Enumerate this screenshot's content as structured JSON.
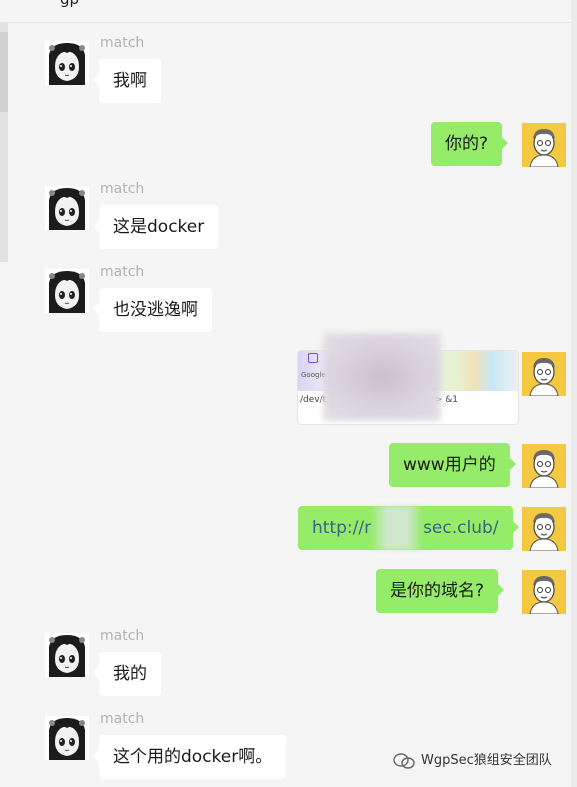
{
  "window": {
    "title_fragment": "gp"
  },
  "messages": [
    {
      "sender": "match",
      "text": "我啊",
      "side": "in"
    },
    {
      "text": "你的?",
      "side": "out"
    },
    {
      "sender": "match",
      "text": "这是docker",
      "side": "in"
    },
    {
      "sender": "match",
      "text": "也没逃逸啊",
      "side": "in"
    },
    {
      "type": "screenshot-card",
      "side": "out",
      "google_text": "Google",
      "path_text": "/dev/t",
      "tail_text": "> &1"
    },
    {
      "text": "www用户的",
      "side": "out"
    },
    {
      "text_start": "http://r",
      "text_end": "sec.club/",
      "side": "out"
    },
    {
      "text": "是你的域名?",
      "side": "out"
    },
    {
      "sender": "match",
      "text": "我的",
      "side": "in"
    },
    {
      "sender": "match",
      "text": "这个用的docker啊。",
      "side": "in"
    }
  ],
  "watermark": {
    "text": "WgpSec狼组安全团队"
  },
  "colors": {
    "outgoing_bubble": "#95ec69",
    "incoming_bubble": "#ffffff",
    "background": "#f5f5f5",
    "sender_name": "#b2b2b2"
  }
}
